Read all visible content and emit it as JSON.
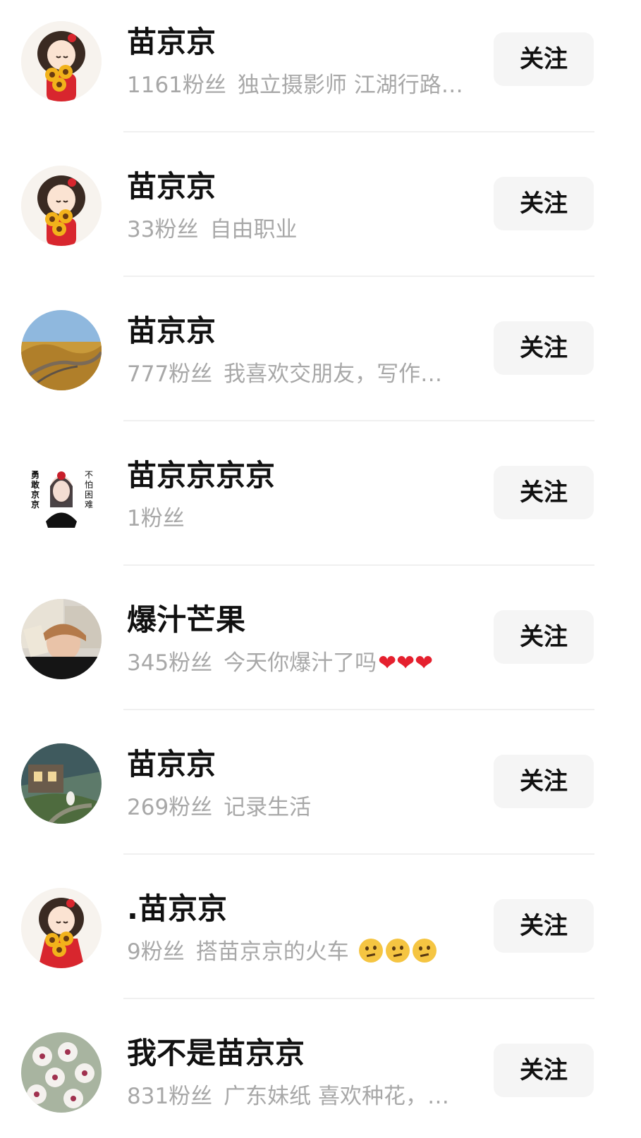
{
  "follow_label": "关注",
  "users": [
    {
      "name": "苗京京",
      "fans": "1161粉丝",
      "bio": "独立摄影师 江湖行路…",
      "avatar": "cartoon-girl-sunflowers-avatar",
      "emoji": ""
    },
    {
      "name": "苗京京",
      "fans": "33粉丝",
      "bio": "自由职业",
      "avatar": "cartoon-girl-sunflowers-avatar",
      "emoji": ""
    },
    {
      "name": "苗京京",
      "fans": "777粉丝",
      "bio": "我喜欢交朋友，写作…",
      "avatar": "great-wall-landscape-avatar",
      "emoji": ""
    },
    {
      "name": "苗京京京京",
      "fans": "1粉丝",
      "bio": "",
      "avatar": "brave-girl-cartoon-avatar",
      "emoji": "",
      "avatar_text_left": "勇敢京京",
      "avatar_text_right": "不怕困难"
    },
    {
      "name": "爆汁芒果",
      "fans": "345粉丝",
      "bio": "今天你爆汁了吗",
      "avatar": "photo-girl-money-avatar",
      "emoji": "❤❤❤"
    },
    {
      "name": "苗京京",
      "fans": "269粉丝",
      "bio": "记录生活",
      "avatar": "garden-house-painting-avatar",
      "emoji": ""
    },
    {
      "name": ".苗京京",
      "fans": "9粉丝",
      "bio": "搭苗京京的火车",
      "avatar": "cartoon-girl-sunflowers-avatar",
      "emoji": "thinking-face-x3"
    },
    {
      "name": "我不是苗京京",
      "fans": "831粉丝",
      "bio": "广东妹纸 喜欢种花，…",
      "avatar": "white-flowers-avatar",
      "emoji": ""
    }
  ]
}
